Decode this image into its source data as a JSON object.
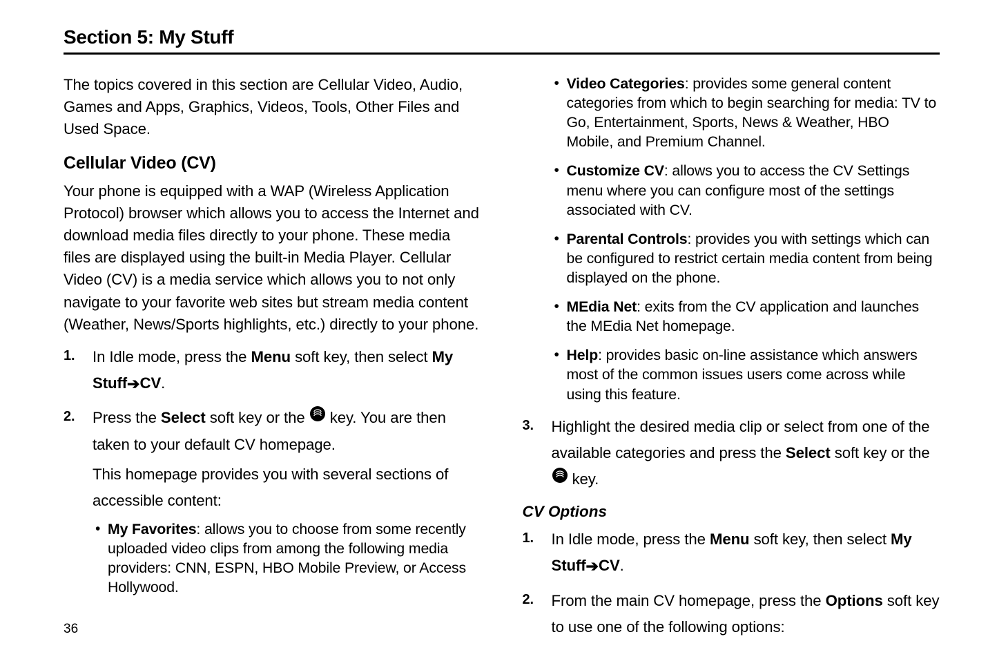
{
  "section_title": "Section 5: My Stuff",
  "intro": "The topics covered in this section are Cellular Video, Audio, Games and Apps, Graphics, Videos, Tools, Other Files and Used Space.",
  "h2_cv": "Cellular Video (CV)",
  "cv_para": "Your phone is equipped with a WAP (Wireless Application Protocol) browser which allows you to access the Internet and download media files directly to your phone. These media files are displayed using the built-in Media Player. Cellular Video (CV) is a media service which allows you to not only navigate to your favorite web sites but stream media content (Weather, News/Sports highlights, etc.) directly to your phone.",
  "left_steps": {
    "s1_pre": "In Idle mode, press the ",
    "s1_menu": "Menu",
    "s1_mid": " soft key, then select ",
    "s1_path_a": "My Stuff",
    "s1_arrow": " ➔ ",
    "s1_path_b": "CV",
    "s1_end": ".",
    "s2_pre": "Press the ",
    "s2_select": "Select",
    "s2_mid": " soft key or the ",
    "s2_post": " key. You are then taken to your default CV homepage.",
    "s2_body": "This homepage provides you with several sections of accessible content:"
  },
  "left_bullets": {
    "myfav_label": "My Favorites",
    "myfav_text": ": allows you to choose from some recently uploaded video clips from among the following media providers: CNN, ESPN, HBO Mobile Preview, or Access Hollywood."
  },
  "right_bullets": {
    "vidcat_label": "Video Categories",
    "vidcat_text": ": provides some general content categories from which to begin searching for media: TV to Go, Entertainment, Sports, News & Weather, HBO Mobile, and Premium Channel.",
    "custcv_label": "Customize CV",
    "custcv_text": ": allows you to access the CV Settings menu where you can configure most of the settings associated with CV.",
    "parental_label": "Parental Controls",
    "parental_text": ": provides you with settings which can be configured to restrict certain media content from being displayed on the phone.",
    "medianet_label": "MEdia Net",
    "medianet_text": ": exits from the CV application and launches the MEdia Net homepage.",
    "help_label": "Help",
    "help_text": ": provides basic on-line assistance which answers most of the common issues users come across while using this feature."
  },
  "right_step3": {
    "pre": "Highlight the desired media clip or select from one of the available categories and press the ",
    "select": "Select",
    "mid": " soft key or the ",
    "post": " key."
  },
  "h3_cvoptions": "CV Options",
  "cvopt_steps": {
    "s1_pre": "In Idle mode, press the ",
    "s1_menu": "Menu",
    "s1_mid": " soft key, then select ",
    "s1_path_a": "My Stuff",
    "s1_arrow": " ➔ ",
    "s1_path_b": "CV",
    "s1_end": ".",
    "s2_pre": "From the main CV homepage, press the ",
    "s2_options": "Options",
    "s2_post": " soft key to use one of the following options:"
  },
  "nums": {
    "n1": "1.",
    "n2": "2.",
    "n3": "3."
  },
  "page_number": "36"
}
